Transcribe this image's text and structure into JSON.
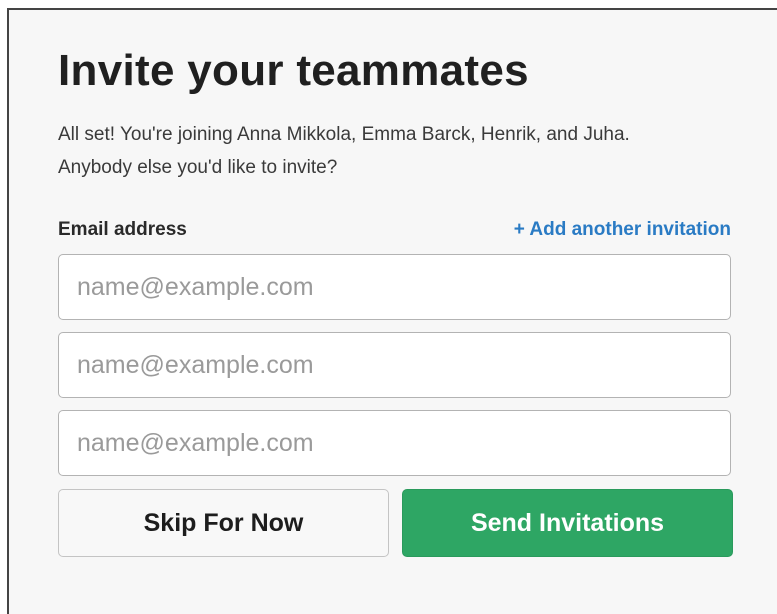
{
  "dialog": {
    "title": "Invite your teammates",
    "subtitle_line1": "All set! You're joining Anna Mikkola, Emma Barck, Henrik, and Juha.",
    "subtitle_line2": "Anybody else you'd like to invite?"
  },
  "form": {
    "email_label": "Email address",
    "add_invitation_link": "+ Add another invitation",
    "inputs": [
      {
        "value": "",
        "placeholder": "name@example.com"
      },
      {
        "value": "",
        "placeholder": "name@example.com"
      },
      {
        "value": "",
        "placeholder": "name@example.com"
      }
    ]
  },
  "actions": {
    "skip_label": "Skip For Now",
    "send_label": "Send Invitations"
  },
  "colors": {
    "accent_green": "#2ea664",
    "link_blue": "#2a7bc4",
    "background": "#f7f7f7"
  }
}
